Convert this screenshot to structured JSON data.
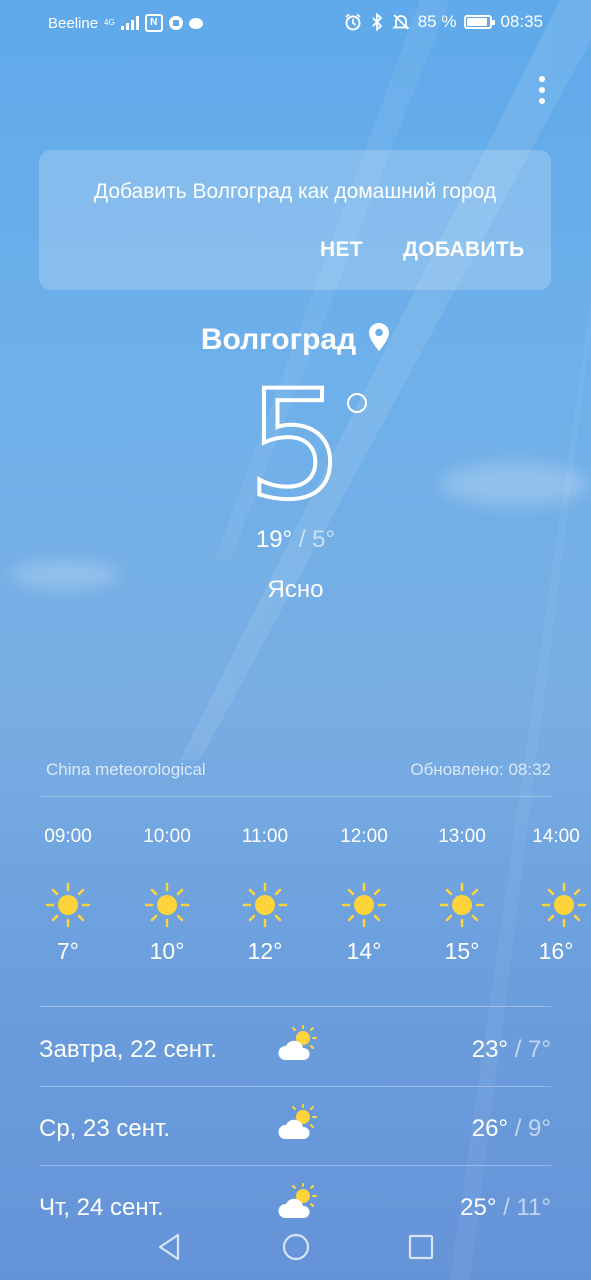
{
  "status_bar": {
    "carrier": "Beeline",
    "network": "4G",
    "battery": "85 %",
    "time": "08:35",
    "icons": [
      "signal-icon",
      "nfc-icon",
      "record-icon",
      "message-icon",
      "alarm-icon",
      "bluetooth-icon",
      "mute-icon",
      "battery-icon"
    ]
  },
  "banner": {
    "message": "Добавить Волгоград как домашний город",
    "no_label": "НЕТ",
    "add_label": "ДОБАВИТЬ"
  },
  "current": {
    "city": "Волгоград",
    "temperature": "5",
    "high": "19°",
    "separator": "/",
    "low": "5°",
    "condition": "Ясно"
  },
  "source": {
    "provider": "China meteorological",
    "updated": "Обновлено: 08:32"
  },
  "hourly": [
    {
      "time": "09:00",
      "temp": "7°",
      "icon": "sun-icon"
    },
    {
      "time": "10:00",
      "temp": "10°",
      "icon": "sun-icon"
    },
    {
      "time": "11:00",
      "temp": "12°",
      "icon": "sun-icon"
    },
    {
      "time": "12:00",
      "temp": "14°",
      "icon": "sun-icon"
    },
    {
      "time": "13:00",
      "temp": "15°",
      "icon": "sun-icon"
    },
    {
      "time": "14:00",
      "temp": "16°",
      "icon": "sun-icon"
    }
  ],
  "daily": [
    {
      "day": "Завтра, 22 сент.",
      "high": "23°",
      "low": "7°",
      "icon": "partly-cloudy-icon"
    },
    {
      "day": "Ср, 23 сент.",
      "high": "26°",
      "low": "9°",
      "icon": "partly-cloudy-icon"
    },
    {
      "day": "Чт, 24 сент.",
      "high": "25°",
      "low": "11°",
      "icon": "partly-cloudy-icon"
    }
  ],
  "colors": {
    "sky_top": "#5fa9ea",
    "sky_bottom": "#6593d8",
    "sun": "#ffd43b"
  }
}
